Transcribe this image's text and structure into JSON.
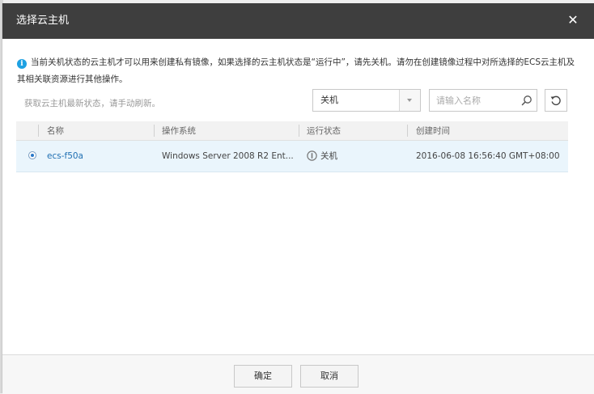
{
  "dialog": {
    "title": "选择云主机",
    "close_symbol": "✕",
    "close_icon": "close-icon"
  },
  "notice": {
    "icon": "info-icon",
    "icon_glyph": "i",
    "text": "当前关机状态的云主机才可以用来创建私有镜像，如果选择的云主机状态是“运行中”，请先关机。请勿在创建镜像过程中对所选择的ECS云主机及其相关联资源进行其他操作。"
  },
  "toolbar": {
    "hint": "获取云主机最新状态，请手动刷新。",
    "status_filter": {
      "selected": "关机",
      "icon": "chevron-down-icon"
    },
    "search": {
      "placeholder": "请输入名称",
      "value": "",
      "icon": "search-icon"
    },
    "refresh_icon": "refresh-icon"
  },
  "table": {
    "columns": [
      "名称",
      "操作系统",
      "运行状态",
      "创建时间"
    ],
    "rows": [
      {
        "selected": true,
        "name": "ecs-f50a",
        "os": "Windows Server 2008 R2 Ent...",
        "status": "关机",
        "status_icon": "stopped-icon",
        "created": "2016-06-08 16:56:40 GMT+08:00"
      }
    ]
  },
  "footer": {
    "ok_label": "确定",
    "cancel_label": "取消"
  },
  "colors": {
    "titlebar": "#3e3e3e",
    "info_blue": "#1ea1e2",
    "link_blue": "#1f6fb2",
    "row_selected": "#eaf5fc"
  }
}
